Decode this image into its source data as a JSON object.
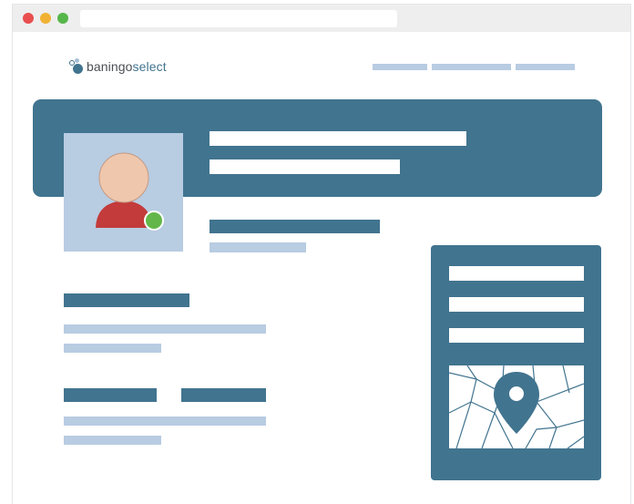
{
  "window": {
    "traffic_lights": [
      "close",
      "minimize",
      "zoom"
    ],
    "colors": {
      "close": "#e94f4f",
      "minimize": "#f1b233",
      "zoom": "#56b64a",
      "titlebar": "#eeeeee"
    }
  },
  "header": {
    "logo": {
      "brand": "baningo",
      "product": "select",
      "icon": "bubbles-logo-icon"
    },
    "nav_links": [
      "placeholder-link",
      "placeholder-link",
      "placeholder-link"
    ]
  },
  "profile": {
    "avatar_icon": "user-avatar-icon",
    "status": "online",
    "status_color": "#63b74a"
  },
  "side_panel": {
    "fields": [
      "placeholder-field",
      "placeholder-field",
      "placeholder-field"
    ],
    "map_icon": "location-pin-icon"
  },
  "colors": {
    "primary": "#41748f",
    "light_accent": "#b8cce2",
    "logo_text": "#4a4f55",
    "avatar_skin": "#efc7ad",
    "avatar_shirt": "#c33b3b"
  }
}
